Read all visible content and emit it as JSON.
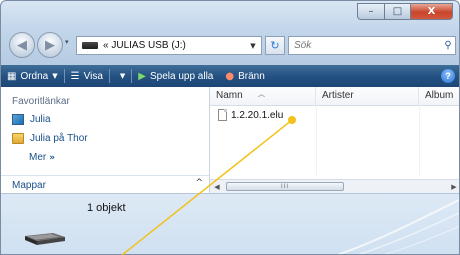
{
  "window": {
    "caption": {
      "minimize": "–",
      "maximize": "□",
      "close": "X"
    }
  },
  "navigation": {
    "history_arrow": "▾",
    "address": {
      "prefix": "«",
      "path": "JULIAS USB (J:)"
    },
    "search": {
      "placeholder": "Sök"
    }
  },
  "toolbar": {
    "items": [
      {
        "label": "Ordna",
        "icon": "organize-icon"
      },
      {
        "label": "Visa",
        "icon": "views-icon"
      },
      {
        "label": "Spela upp alla",
        "icon": "play-icon"
      },
      {
        "label": "Bränn",
        "icon": "burn-icon"
      }
    ],
    "help": "?"
  },
  "nav_pane": {
    "favorites_title": "Favoritlänkar",
    "links": [
      {
        "label": "Julia",
        "icon": "user-folder-icon"
      },
      {
        "label": "Julia på Thor",
        "icon": "folder-icon"
      }
    ],
    "more": "Mer",
    "more_glyph": "»",
    "folders_title": "Mappar",
    "folders_chevron": "^"
  },
  "content": {
    "columns": [
      "Namn",
      "Artister",
      "Album"
    ],
    "files": [
      {
        "name": "1.2.20.1.elu",
        "icon": "file-icon"
      }
    ],
    "scroll_thumb": "III"
  },
  "details": {
    "count": "1 objekt",
    "icon": "usb-drive-icon"
  },
  "colors": {
    "toolbar": "#245283",
    "annotation_line": "#f2c21b",
    "link": "#1a4f8b"
  }
}
